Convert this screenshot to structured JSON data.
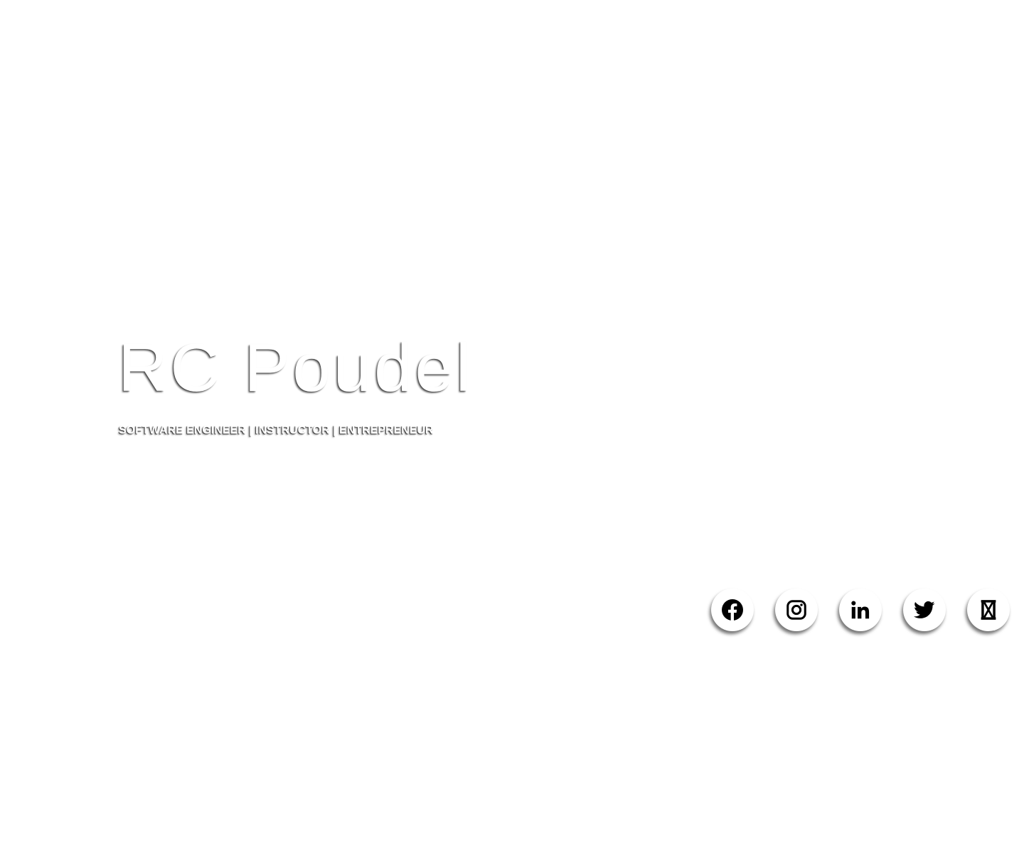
{
  "hero": {
    "name": "RC Poudel",
    "tagline": "SOFTWARE ENGINEER | INSTRUCTOR | ENTREPRENEUR"
  },
  "social": [
    {
      "icon": "facebook-icon"
    },
    {
      "icon": "instagram-icon"
    },
    {
      "icon": "linkedin-icon"
    },
    {
      "icon": "twitter-icon"
    },
    {
      "icon": "hourglass-icon"
    }
  ],
  "colors": {
    "background": "#ffffff",
    "icon": "#000000"
  }
}
